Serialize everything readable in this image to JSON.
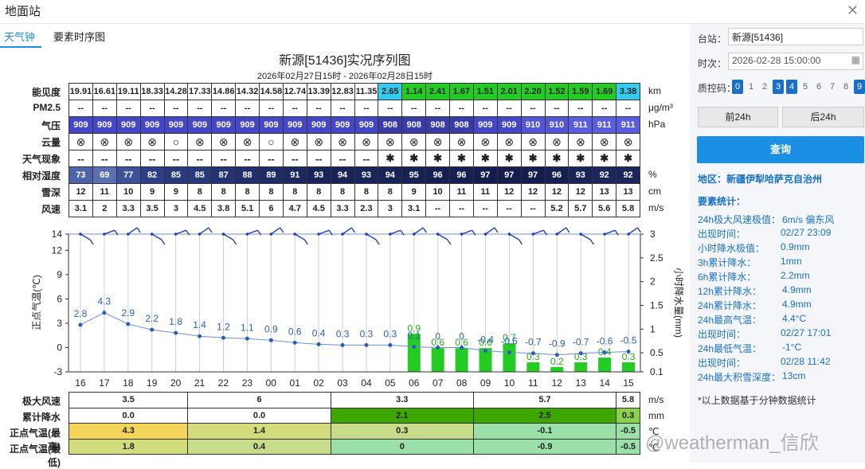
{
  "window": {
    "title": "地面站",
    "close_icon": "close-icon"
  },
  "tabs": [
    {
      "label": "天气钟",
      "active": true
    },
    {
      "label": "要素时序图",
      "active": false
    }
  ],
  "chart_title": "新源[51436]实况序列图",
  "chart_subtitle": "2026年02月27日15时 - 2026年02月28日15时",
  "hours": [
    "16",
    "17",
    "18",
    "19",
    "20",
    "21",
    "22",
    "23",
    "00",
    "01",
    "02",
    "03",
    "04",
    "05",
    "06",
    "07",
    "08",
    "09",
    "10",
    "11",
    "12",
    "13",
    "14",
    "15"
  ],
  "table": {
    "rows": [
      {
        "label": "能见度",
        "unit": "km",
        "values": [
          "19.91",
          "16.61",
          "19.11",
          "18.33",
          "14.28",
          "17.33",
          "14.86",
          "14.32",
          "14.58",
          "12.74",
          "13.39",
          "12.83",
          "11.35",
          "2.65",
          "1.14",
          "2.41",
          "1.67",
          "1.51",
          "2.01",
          "2.20",
          "1.52",
          "1.59",
          "1.69",
          "3.38"
        ],
        "colors": [
          "#ffffff",
          "#ffffff",
          "#ffffff",
          "#ffffff",
          "#ffffff",
          "#ffffff",
          "#ffffff",
          "#ffffff",
          "#ffffff",
          "#ffffff",
          "#ffffff",
          "#ffffff",
          "#ffffff",
          "#33ccee",
          "#22cc22",
          "#22cc22",
          "#22cc22",
          "#22cc22",
          "#22cc22",
          "#22cc22",
          "#22cc22",
          "#22cc22",
          "#22cc22",
          "#33ccee"
        ]
      },
      {
        "label": "PM2.5",
        "unit": "μg/m³",
        "values": [
          "--",
          "--",
          "--",
          "--",
          "--",
          "--",
          "--",
          "--",
          "--",
          "--",
          "--",
          "--",
          "--",
          "--",
          "--",
          "--",
          "--",
          "--",
          "--",
          "--",
          "--",
          "--",
          "--",
          "--"
        ]
      },
      {
        "label": "气压",
        "unit": "hPa",
        "values": [
          "909",
          "909",
          "909",
          "909",
          "909",
          "909",
          "909",
          "909",
          "909",
          "909",
          "909",
          "909",
          "909",
          "908",
          "908",
          "908",
          "908",
          "909",
          "909",
          "910",
          "910",
          "911",
          "911",
          "911"
        ],
        "colors": [
          "#4646c8",
          "#4646c8",
          "#4646c8",
          "#4646c8",
          "#4646c8",
          "#4646c8",
          "#4646c8",
          "#4646c8",
          "#4646c8",
          "#4646c8",
          "#4646c8",
          "#4646c8",
          "#4646c8",
          "#3a3aa8",
          "#3a3aa8",
          "#3a3aa8",
          "#3a3aa8",
          "#4646c8",
          "#4646c8",
          "#5555d8",
          "#5555d8",
          "#5c5ce0",
          "#5c5ce0",
          "#5c5ce0"
        ]
      },
      {
        "label": "云量",
        "unit": "",
        "values": [
          "⊗",
          "⊗",
          "⊗",
          "⊗",
          "○",
          "⊗",
          "⊗",
          "⊗",
          "○",
          "⊗",
          "⊗",
          "⊗",
          "⊗",
          "⊗",
          "⊗",
          "⊗",
          "⊗",
          "⊗",
          "⊗",
          "⊗",
          "⊗",
          "⊗",
          "⊗",
          "⊗"
        ]
      },
      {
        "label": "天气现象",
        "unit": "",
        "values": [
          "--",
          "--",
          "--",
          "--",
          "--",
          "--",
          "--",
          "--",
          "--",
          "--",
          "--",
          "--",
          "--",
          "✱",
          "✱",
          "✱",
          "✱",
          "✱",
          "✱",
          "✱",
          "✱",
          "✱",
          "✱",
          "✱"
        ]
      },
      {
        "label": "相对湿度",
        "unit": "%",
        "values": [
          "73",
          "69",
          "77",
          "82",
          "85",
          "85",
          "87",
          "88",
          "89",
          "91",
          "93",
          "94",
          "93",
          "94",
          "95",
          "96",
          "96",
          "97",
          "97",
          "97",
          "96",
          "93",
          "92",
          "92"
        ],
        "colors": [
          "#4e64aa",
          "#5a70b5",
          "#3e5299",
          "#2c3f85",
          "#28397c",
          "#28397c",
          "#243473",
          "#222f6c",
          "#202b65",
          "#1c285e",
          "#19255a",
          "#182357",
          "#19255a",
          "#182357",
          "#162154",
          "#151f51",
          "#151f51",
          "#141d4d",
          "#141d4d",
          "#141d4d",
          "#151f51",
          "#19255a",
          "#1a265c",
          "#1a265c"
        ]
      },
      {
        "label": "雪深",
        "unit": "cm",
        "values": [
          "12",
          "11",
          "10",
          "9",
          "9",
          "8",
          "8",
          "8",
          "8",
          "8",
          "8",
          "8",
          "8",
          "8",
          "9",
          "10",
          "11",
          "11",
          "12",
          "12",
          "12",
          "12",
          "13",
          "13"
        ]
      },
      {
        "label": "风速",
        "unit": "m/s",
        "values": [
          "3.1",
          "2",
          "3.3",
          "3.5",
          "3",
          "4.5",
          "3.8",
          "5.1",
          "6",
          "4.7",
          "4.5",
          "3.3",
          "2.3",
          "3",
          "3.1",
          "--",
          "--",
          "--",
          "--",
          "--",
          "5.2",
          "5.7",
          "5.6",
          "5.8"
        ]
      }
    ]
  },
  "chart_data": {
    "type": "line",
    "x": [
      "16",
      "17",
      "18",
      "19",
      "20",
      "21",
      "22",
      "23",
      "00",
      "01",
      "02",
      "03",
      "04",
      "05",
      "06",
      "07",
      "08",
      "09",
      "10",
      "11",
      "12",
      "13",
      "14",
      "15"
    ],
    "series": [
      {
        "axis": "left",
        "values": [
          2.8,
          4.3,
          2.9,
          2.2,
          1.8,
          1.4,
          1.2,
          1.1,
          0.9,
          0.6,
          0.4,
          0.3,
          0.3,
          0.3,
          0.1,
          0,
          0,
          -0.4,
          -0.6,
          -0.7,
          -0.9,
          -0.7,
          -0.6,
          -0.5
        ],
        "color": "#2b5fb4"
      },
      {
        "type": "bar",
        "axis": "right",
        "values": [
          null,
          null,
          null,
          null,
          null,
          null,
          null,
          null,
          null,
          null,
          null,
          null,
          null,
          null,
          0.9,
          0.6,
          0.6,
          0.6,
          0.7,
          0.3,
          0.2,
          0.3,
          0.4,
          0.3
        ],
        "color": "#22cc22"
      }
    ],
    "ylabel_left": "正点气温(℃)",
    "ylabel_right": "小时降水量(mm)",
    "yticks_left": [
      "14",
      "12",
      "9",
      "6",
      "3",
      "0",
      "-3"
    ],
    "yticks_right": [
      "3",
      "2.5",
      "2",
      "1.5",
      "1",
      "0.5",
      "0.1"
    ],
    "ylim_left": [
      -3,
      14
    ],
    "ylim_right": [
      0.1,
      3
    ],
    "wind_barbs": true
  },
  "bottom_table": {
    "rows": [
      {
        "label": "极大风速",
        "unit": "m/s",
        "cells": [
          {
            "v": "3.5",
            "span": 5,
            "bg": "#ffffff"
          },
          {
            "v": "6",
            "span": 6,
            "bg": "#ffffff"
          },
          {
            "v": "3.3",
            "span": 6,
            "bg": "#ffffff"
          },
          {
            "v": "5.7",
            "span": 6,
            "bg": "#ffffff"
          },
          {
            "v": "5.8",
            "span": 1,
            "bg": "#ffffff"
          }
        ]
      },
      {
        "label": "累计降水",
        "unit": "mm",
        "cells": [
          {
            "v": "0.0",
            "span": 5,
            "bg": "#ffffff"
          },
          {
            "v": "0.0",
            "span": 6,
            "bg": "#ffffff"
          },
          {
            "v": "2.1",
            "span": 6,
            "bg": "#3ea600"
          },
          {
            "v": "2.5",
            "span": 6,
            "bg": "#3ea600"
          },
          {
            "v": "0.3",
            "span": 1,
            "bg": "#8cd14e"
          }
        ]
      },
      {
        "label": "正点气温(最高)",
        "unit": "℃",
        "cells": [
          {
            "v": "4.3",
            "span": 5,
            "bg": "#f2d55a"
          },
          {
            "v": "1.4",
            "span": 6,
            "bg": "#d2dc7c"
          },
          {
            "v": "0.3",
            "span": 6,
            "bg": "#c8dc8c"
          },
          {
            "v": "-0.1",
            "span": 6,
            "bg": "#9ae0a8"
          },
          {
            "v": "-0.5",
            "span": 1,
            "bg": "#9ae0a8"
          }
        ]
      },
      {
        "label": "正点气温(最低)",
        "unit": "℃",
        "cells": [
          {
            "v": "1.8",
            "span": 5,
            "bg": "#d2dc7c"
          },
          {
            "v": "0.4",
            "span": 6,
            "bg": "#c8dc8c"
          },
          {
            "v": "0",
            "span": 6,
            "bg": "#9ae0a8"
          },
          {
            "v": "-0.9",
            "span": 6,
            "bg": "#9ae0a8"
          },
          {
            "v": "-0.5",
            "span": 1,
            "bg": "#9ae0a8"
          }
        ]
      }
    ]
  },
  "sidebar": {
    "station_label": "台站：",
    "station_value": "新源[51436]",
    "time_label": "时次：",
    "time_value": "2026-02-28 15:00:00",
    "calendar_icon": "calendar-icon",
    "qc_label": "质控码：",
    "qc_codes": [
      {
        "v": "0",
        "on": true
      },
      {
        "v": "1",
        "on": false
      },
      {
        "v": "2",
        "on": false
      },
      {
        "v": "3",
        "on": true
      },
      {
        "v": "4",
        "on": true
      },
      {
        "v": "5",
        "on": false
      },
      {
        "v": "6",
        "on": false
      },
      {
        "v": "7",
        "on": false
      },
      {
        "v": "8",
        "on": false
      },
      {
        "v": "9",
        "on": true
      }
    ],
    "prev_btn": "前24h",
    "next_btn": "后24h",
    "query_btn": "查询",
    "region": "地区：新疆伊犁哈萨克自治州",
    "stats_title": "要素统计：",
    "stats": [
      {
        "k": "24h极大风速极值：",
        "v": "6m/s 偏东风"
      },
      {
        "k": "出现时间：",
        "v": "02/27 23:09"
      },
      {
        "k": "小时降水极值：",
        "v": "0.9mm"
      },
      {
        "k": "3h累计降水：",
        "v": "1mm"
      },
      {
        "k": "6h累计降水：",
        "v": "2.2mm"
      },
      {
        "k": "12h累计降水：",
        "v": "4.9mm"
      },
      {
        "k": "24h累计降水：",
        "v": "4.9mm"
      },
      {
        "k": "24h最高气温：",
        "v": "4.4°C"
      },
      {
        "k": "出现时间：",
        "v": "02/27 17:01"
      },
      {
        "k": "24h最低气温：",
        "v": "-1°C"
      },
      {
        "k": "出现时间：",
        "v": "02/28 11:42"
      },
      {
        "k": "24h最大积雪深度：",
        "v": "13cm"
      }
    ],
    "note": "*以上数据基于分钟数据统计"
  },
  "watermark": "@weatherman_信欣"
}
